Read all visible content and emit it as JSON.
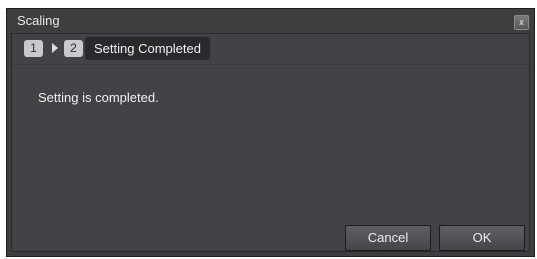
{
  "window": {
    "title": "Scaling",
    "close_label": "x"
  },
  "steps": {
    "step1_number": "1",
    "step2_number": "2",
    "current_label": "Setting Completed"
  },
  "main": {
    "message": "Setting is completed."
  },
  "buttons": {
    "cancel_label": "Cancel",
    "ok_label": "OK"
  },
  "colors": {
    "window_bg": "#3e3e3e",
    "client_bg": "#434345",
    "step_badge": "#c9c9c9",
    "current_step_bg": "#2a2a2c"
  }
}
